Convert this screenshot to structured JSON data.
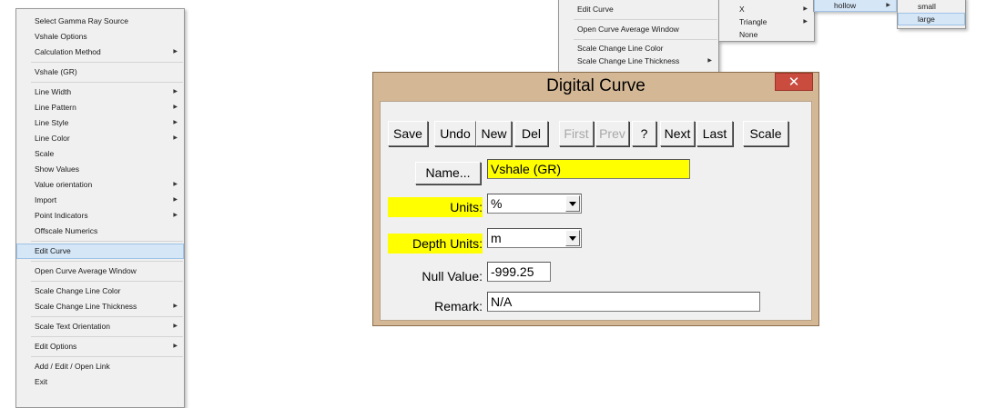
{
  "main_menu": {
    "items": [
      {
        "label": "Select Gamma Ray Source",
        "submenu": false
      },
      {
        "label": "Vshale Options",
        "submenu": false
      },
      {
        "label": "Calculation Method",
        "submenu": true
      },
      {
        "label": "Vshale (GR)",
        "submenu": false
      },
      {
        "label": "Line Width",
        "submenu": true
      },
      {
        "label": "Line Pattern",
        "submenu": true
      },
      {
        "label": "Line Style",
        "submenu": true
      },
      {
        "label": "Line Color",
        "submenu": true
      },
      {
        "label": "Scale",
        "submenu": false
      },
      {
        "label": "Show Values",
        "submenu": false
      },
      {
        "label": "Value orientation",
        "submenu": true
      },
      {
        "label": "Import",
        "submenu": true
      },
      {
        "label": "Point Indicators",
        "submenu": true
      },
      {
        "label": "Offscale Numerics",
        "submenu": false
      },
      {
        "label": "Edit Curve",
        "submenu": false
      },
      {
        "label": "Open Curve Average Window",
        "submenu": false
      },
      {
        "label": "Scale Change Line Color",
        "submenu": false
      },
      {
        "label": "Scale Change Line Thickness",
        "submenu": true
      },
      {
        "label": "Scale Text Orientation",
        "submenu": true
      },
      {
        "label": "Edit Options",
        "submenu": true
      },
      {
        "label": "Add / Edit / Open Link",
        "submenu": false
      },
      {
        "label": "Exit",
        "submenu": false
      }
    ]
  },
  "top_menu": {
    "items": [
      "Edit Curve",
      "Open Curve Average Window",
      "Scale Change Line Color",
      "Scale Change Line Thickness"
    ]
  },
  "shape_menu": {
    "items": [
      "X",
      "Triangle",
      "None"
    ]
  },
  "style_menu": {
    "items": [
      "hollow"
    ]
  },
  "size_menu": {
    "items": [
      "small",
      "large"
    ]
  },
  "dialog": {
    "title": "Digital Curve",
    "close_glyph": "✕",
    "buttons": {
      "save": "Save",
      "undo": "Undo",
      "new": "New",
      "del": "Del",
      "first": "First",
      "prev": "Prev",
      "help": "?",
      "next": "Next",
      "last": "Last",
      "scale": "Scale",
      "name": "Name..."
    },
    "fields": {
      "name_value": "Vshale (GR)",
      "units_label": "Units:",
      "units_value": "%",
      "depth_units_label": "Depth Units:",
      "depth_units_value": "m",
      "null_label": "Null Value:",
      "null_value": "-999.25",
      "remark_label": "Remark:",
      "remark_value": "N/A"
    }
  },
  "icons": {
    "submenu_arrow": "▶",
    "dropdown_arrow": "chevron-down-icon"
  }
}
